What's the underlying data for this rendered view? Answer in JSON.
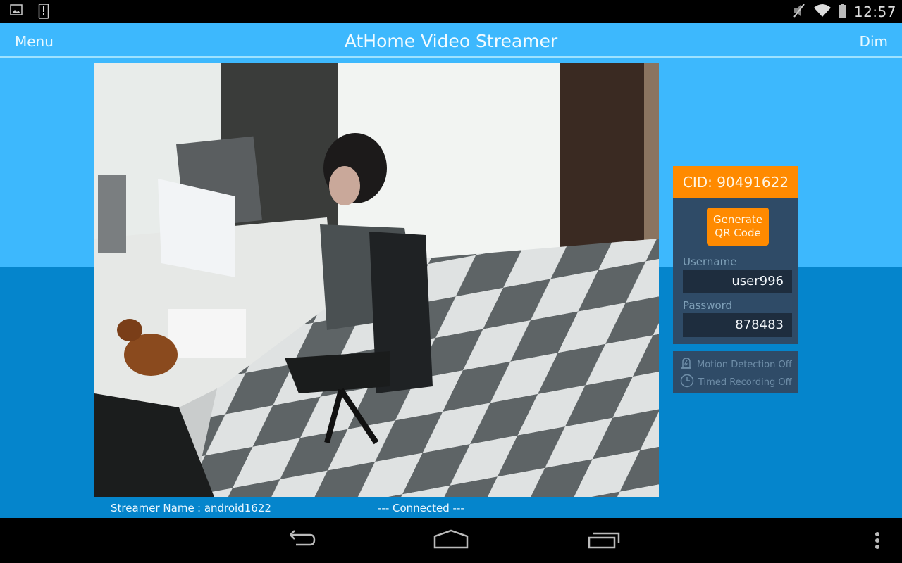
{
  "statusbar": {
    "left_icons": [
      "gallery-notification-icon",
      "alert-notification-icon"
    ],
    "right_icons": [
      "mute-icon",
      "wifi-icon",
      "battery-icon"
    ],
    "time": "12:57"
  },
  "appbar": {
    "menu_label": "Menu",
    "title": "AtHome Video Streamer",
    "dim_label": "Dim"
  },
  "video": {
    "description": "Live camera preview of an office with a person seated at a desk"
  },
  "footer": {
    "streamer_name_label": "Streamer Name",
    "streamer_name_value": ": android1622",
    "connection_status": "--- Connected ---"
  },
  "panel": {
    "cid": "CID: 90491622",
    "qr_button_line1": "Generate",
    "qr_button_line2": "QR Code",
    "username_label": "Username",
    "username_value": "user996",
    "password_label": "Password",
    "password_value": "878483"
  },
  "status": {
    "motion_detection": "Motion Detection Off",
    "timed_recording": "Timed Recording Off"
  },
  "navbar": {
    "buttons": [
      "back",
      "home",
      "recent-apps",
      "overflow-menu"
    ]
  },
  "colors": {
    "appbar_blue": "#3db8fd",
    "lower_blue": "#0585cc",
    "accent_orange": "#ff8a00",
    "panel_navy": "#2f4b67"
  }
}
